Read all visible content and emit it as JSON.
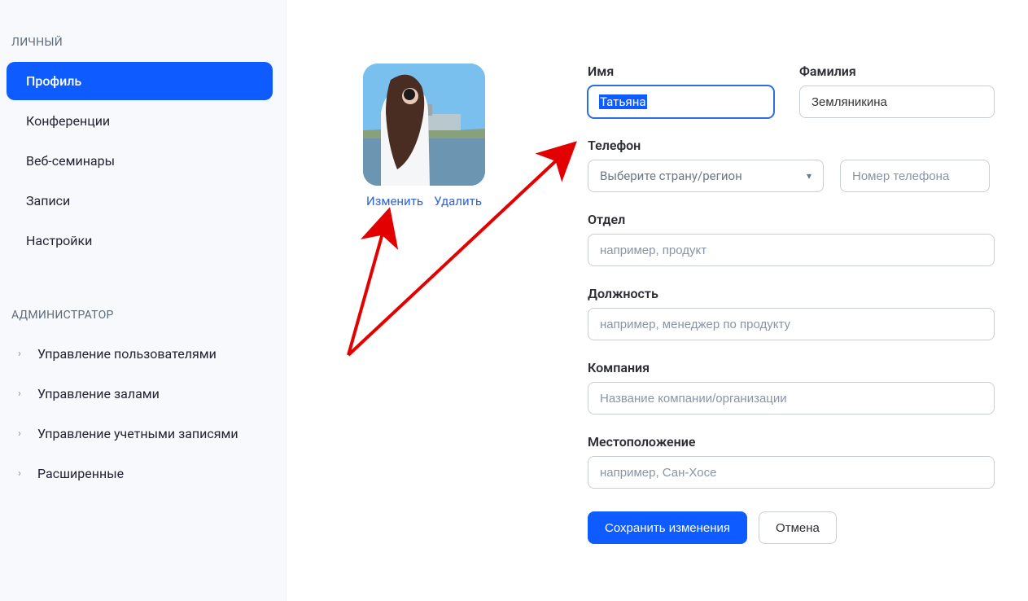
{
  "sidebar": {
    "section_personal": "ЛИЧНЫЙ",
    "items_personal": [
      {
        "label": "Профиль",
        "active": true
      },
      {
        "label": "Конференции"
      },
      {
        "label": "Веб-семинары"
      },
      {
        "label": "Записи"
      },
      {
        "label": "Настройки"
      }
    ],
    "section_admin": "АДМИНИСТРАТОР",
    "items_admin": [
      {
        "label": "Управление пользователями"
      },
      {
        "label": "Управление залами"
      },
      {
        "label": "Управление учетными записями"
      },
      {
        "label": "Расширенные"
      }
    ]
  },
  "avatar": {
    "change": "Изменить",
    "delete": "Удалить"
  },
  "form": {
    "first_name_label": "Имя",
    "first_name_value": "Татьяна",
    "last_name_label": "Фамилия",
    "last_name_value": "Земляникина",
    "phone_label": "Телефон",
    "phone_select_placeholder": "Выберите страну/регион",
    "phone_input_placeholder": "Номер телефона",
    "department_label": "Отдел",
    "department_placeholder": "например, продукт",
    "position_label": "Должность",
    "position_placeholder": "например, менеджер по продукту",
    "company_label": "Компания",
    "company_placeholder": "Название компании/организации",
    "location_label": "Местоположение",
    "location_placeholder": "например, Сан-Хосе",
    "save": "Сохранить изменения",
    "cancel": "Отмена"
  }
}
